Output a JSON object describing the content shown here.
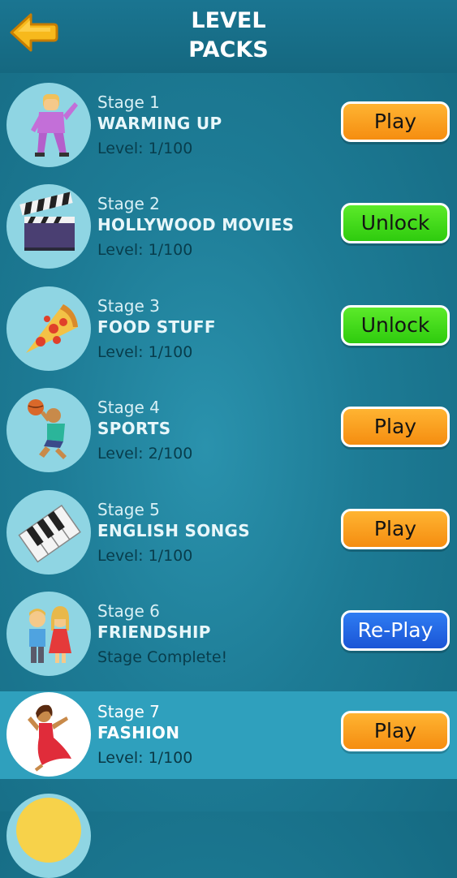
{
  "header": {
    "title_line1": "LEVEL",
    "title_line2": "PACKS"
  },
  "stages": [
    {
      "stage": "Stage 1",
      "name": "WARMING UP",
      "status": "Level: 1/100",
      "button": "Play",
      "icon": "dancing-man-icon"
    },
    {
      "stage": "Stage 2",
      "name": "HOLLYWOOD MOVIES",
      "status": "Level: 1/100",
      "button": "Unlock",
      "icon": "clapperboard-icon"
    },
    {
      "stage": "Stage 3",
      "name": "FOOD STUFF",
      "status": "Level: 1/100",
      "button": "Unlock",
      "icon": "pizza-icon"
    },
    {
      "stage": "Stage 4",
      "name": "SPORTS",
      "status": "Level: 2/100",
      "button": "Play",
      "icon": "basketball-player-icon"
    },
    {
      "stage": "Stage 5",
      "name": "ENGLISH SONGS",
      "status": "Level: 1/100",
      "button": "Play",
      "icon": "piano-keys-icon"
    },
    {
      "stage": "Stage 6",
      "name": "FRIENDSHIP",
      "status": "Stage Complete!",
      "button": "Re-Play",
      "icon": "couple-icon"
    },
    {
      "stage": "Stage 7",
      "name": "FASHION",
      "status": "Level: 1/100",
      "button": "Play",
      "icon": "dancing-woman-icon"
    }
  ],
  "colors": {
    "play": "#f79a18",
    "unlock": "#3ad616",
    "replay": "#2366e6",
    "background": "#1d7b95",
    "highlight_row": "#2fa0bd"
  }
}
